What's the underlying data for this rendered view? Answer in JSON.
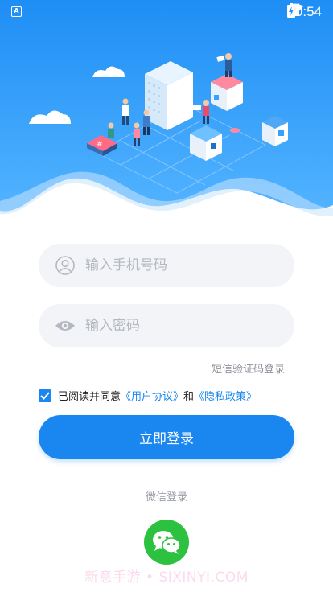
{
  "status_bar": {
    "time": "10:54",
    "icons": [
      "app-notification-icon",
      "wifi-icon",
      "signal-icon",
      "battery-charging-icon"
    ]
  },
  "hero": {
    "illustration": "isometric-data-center-team-illustration"
  },
  "login_form": {
    "phone_placeholder": "输入手机号码",
    "password_placeholder": "输入密码",
    "sms_login_link": "短信验证码登录",
    "agreement": {
      "checked": true,
      "prefix": "已阅读并同意",
      "user_agreement": "《用户协议》",
      "joiner": "和",
      "privacy_policy": "《隐私政策》"
    },
    "login_button": "立即登录"
  },
  "third_party": {
    "label": "微信登录",
    "wechat_icon": "wechat-icon"
  },
  "watermark": "新意手游 • SIXINYI.COM",
  "colors": {
    "primary": "#1a86f0",
    "hero_top": "#1e8ef5",
    "hero_bottom": "#4fb0ff",
    "wechat": "#2dc140",
    "field_bg": "#f3f4f7"
  }
}
